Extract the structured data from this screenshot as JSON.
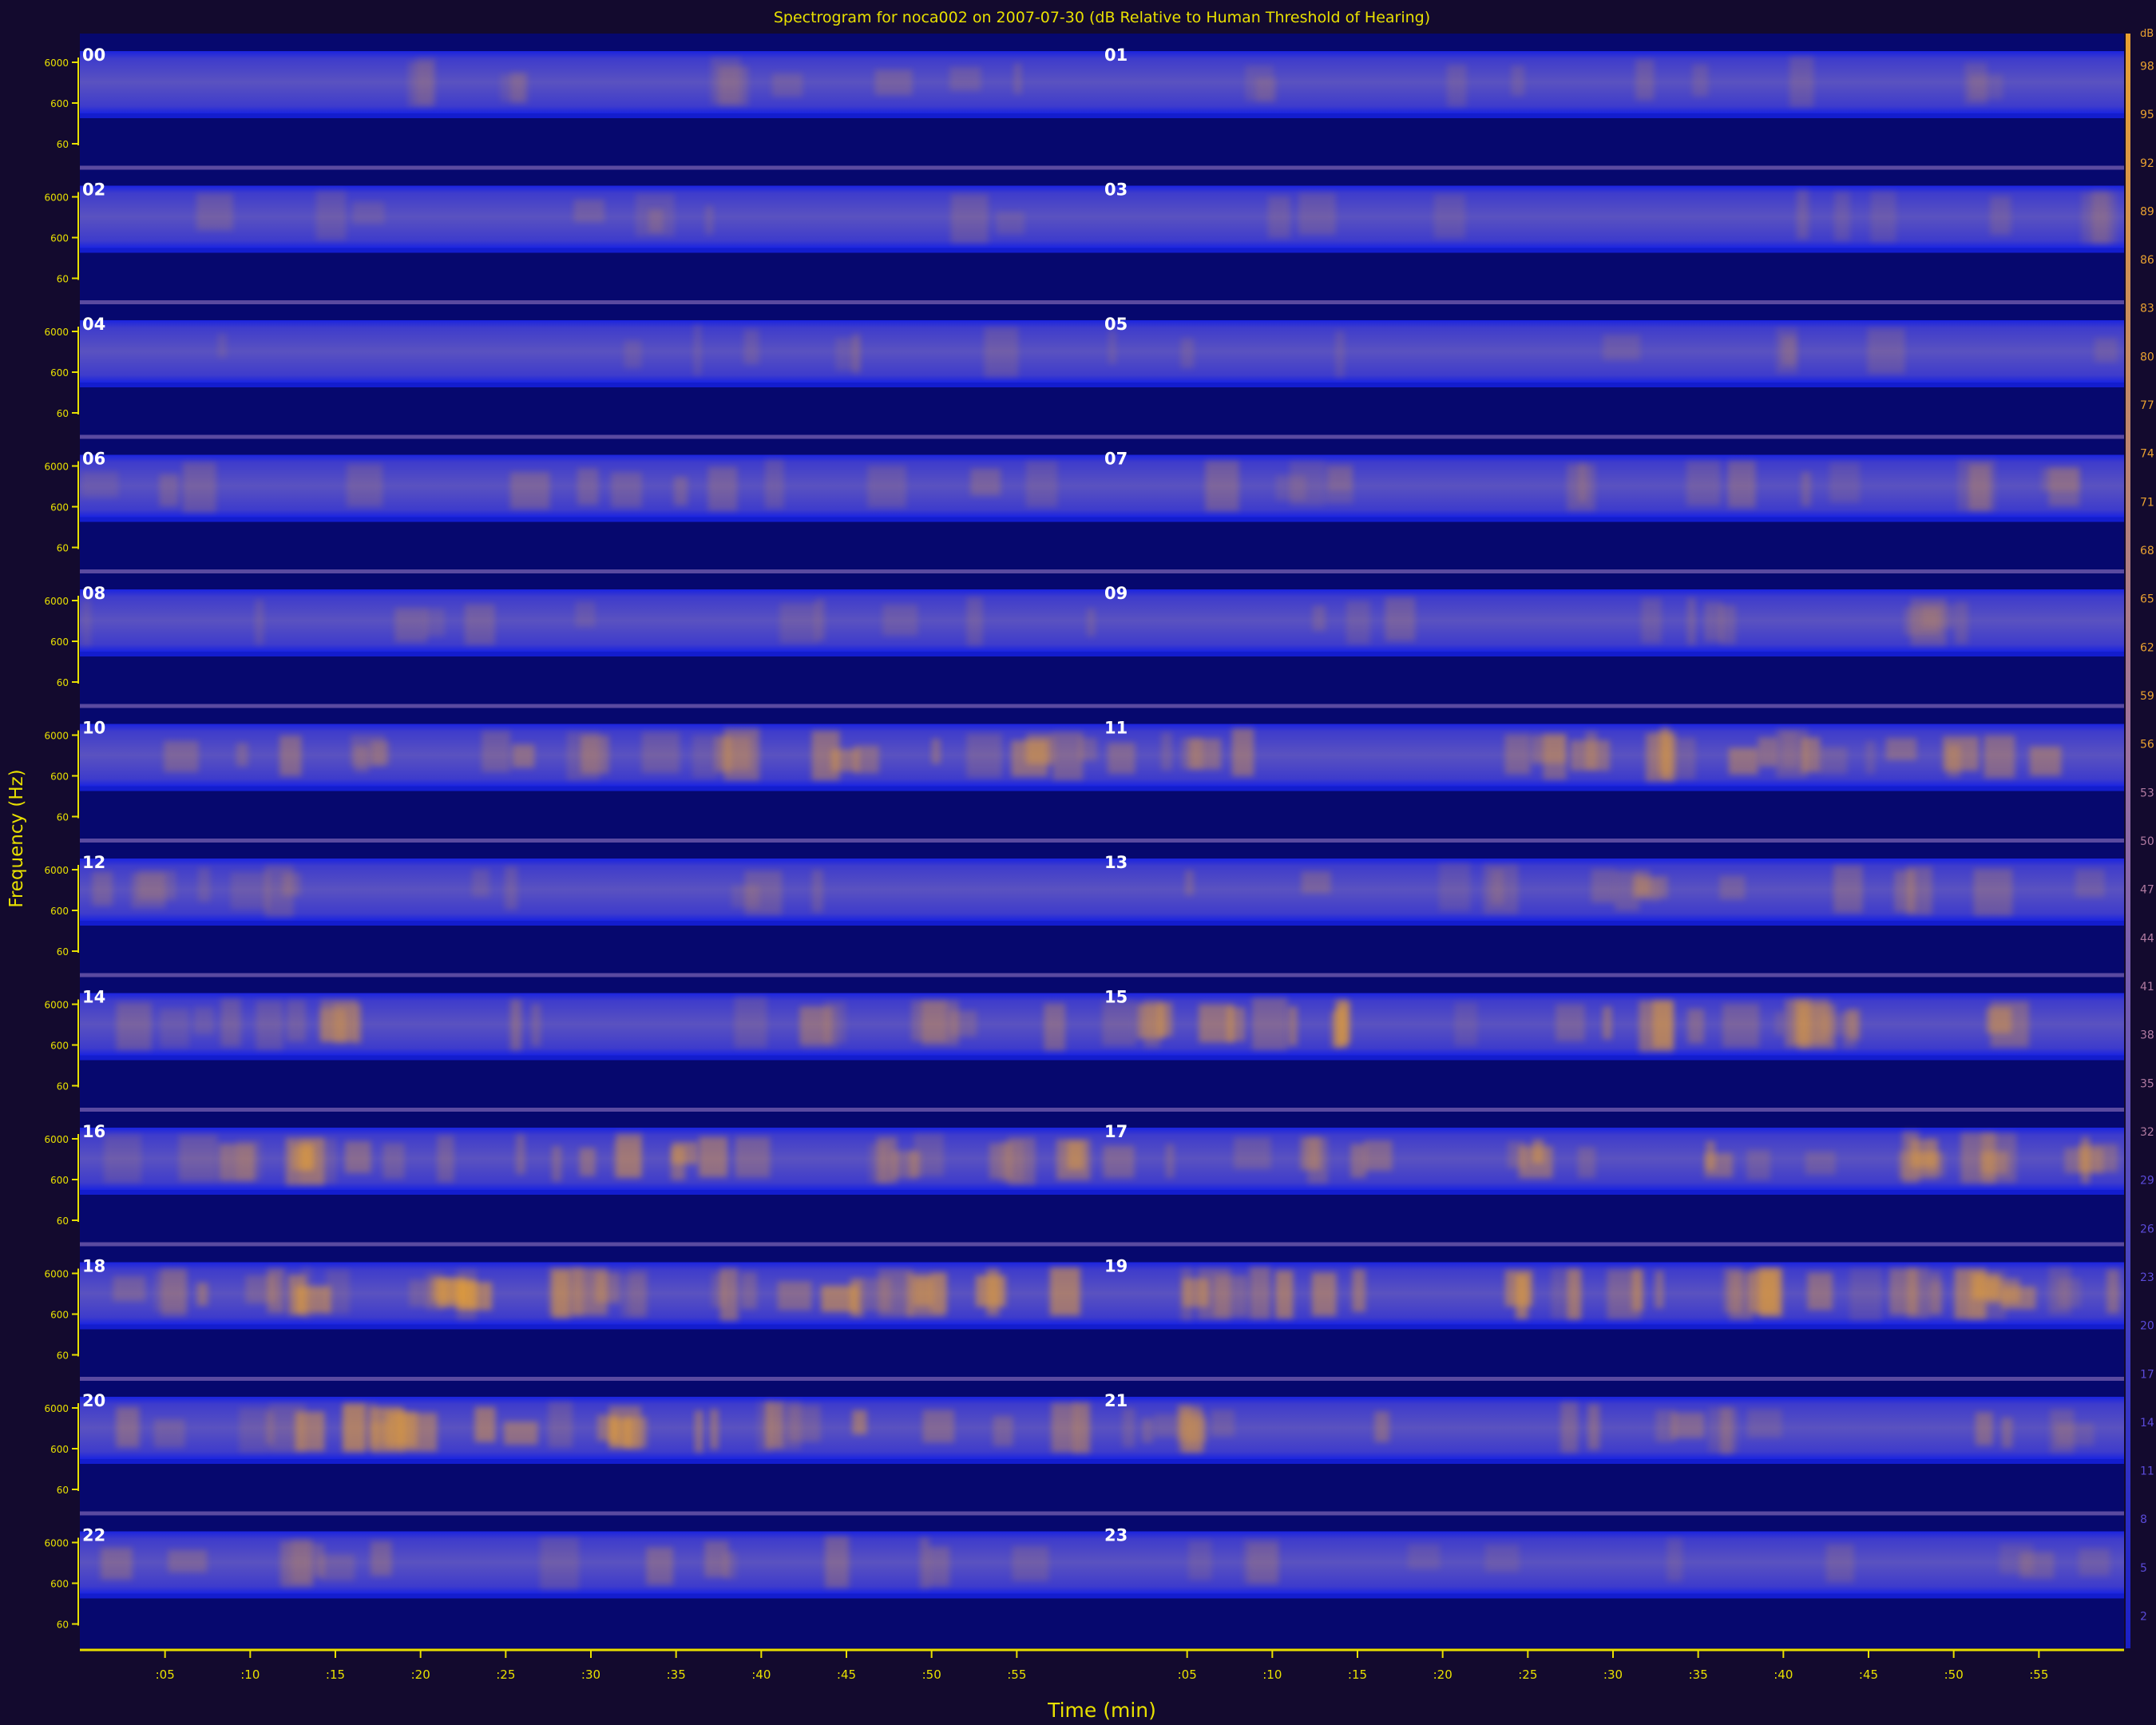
{
  "chart_data": {
    "type": "heatmap",
    "title": "Spectrogram for noca002 on 2007-07-30 (dB Relative to Human Threshold of Hearing)",
    "xlabel": "Time (min)",
    "ylabel": "Frequency (Hz)",
    "panel_labels": [
      "00",
      "01",
      "02",
      "03",
      "04",
      "05",
      "06",
      "07",
      "08",
      "09",
      "10",
      "11",
      "12",
      "13",
      "14",
      "15",
      "16",
      "17",
      "18",
      "19",
      "20",
      "21",
      "22",
      "23"
    ],
    "x_tick_labels": [
      ":05",
      ":10",
      ":15",
      ":20",
      ":25",
      ":30",
      ":35",
      ":40",
      ":45",
      ":50",
      ":55"
    ],
    "x_tick_minutes": [
      5,
      10,
      15,
      20,
      25,
      30,
      35,
      40,
      45,
      50,
      55
    ],
    "x_range_min": [
      0,
      60
    ],
    "freq_tick_labels": [
      "6000",
      "600",
      "60"
    ],
    "colorbar_unit": "dB",
    "colorbar_ticks": [
      98,
      95,
      92,
      89,
      86,
      83,
      80,
      77,
      74,
      71,
      68,
      65,
      62,
      59,
      56,
      53,
      50,
      47,
      44,
      41,
      38,
      35,
      32,
      29,
      26,
      23,
      20,
      17,
      14,
      11,
      8,
      5,
      2
    ],
    "colorbar_range": [
      0,
      100
    ],
    "colors": {
      "background": "#130a2e",
      "plot_bg": "#06086e",
      "band_low": "#1520d8",
      "band_mid": "#4a46b8",
      "hot": "#e8a030",
      "axis": "#e8e000",
      "label_white": "#ffffff",
      "separator": "#5a4aa0"
    },
    "panel_intensity": [
      0.15,
      0.12,
      0.12,
      0.13,
      0.08,
      0.1,
      0.22,
      0.28,
      0.18,
      0.18,
      0.55,
      0.55,
      0.2,
      0.3,
      0.4,
      0.6,
      0.65,
      0.55,
      0.8,
      0.75,
      0.7,
      0.4,
      0.3,
      0.15
    ]
  }
}
